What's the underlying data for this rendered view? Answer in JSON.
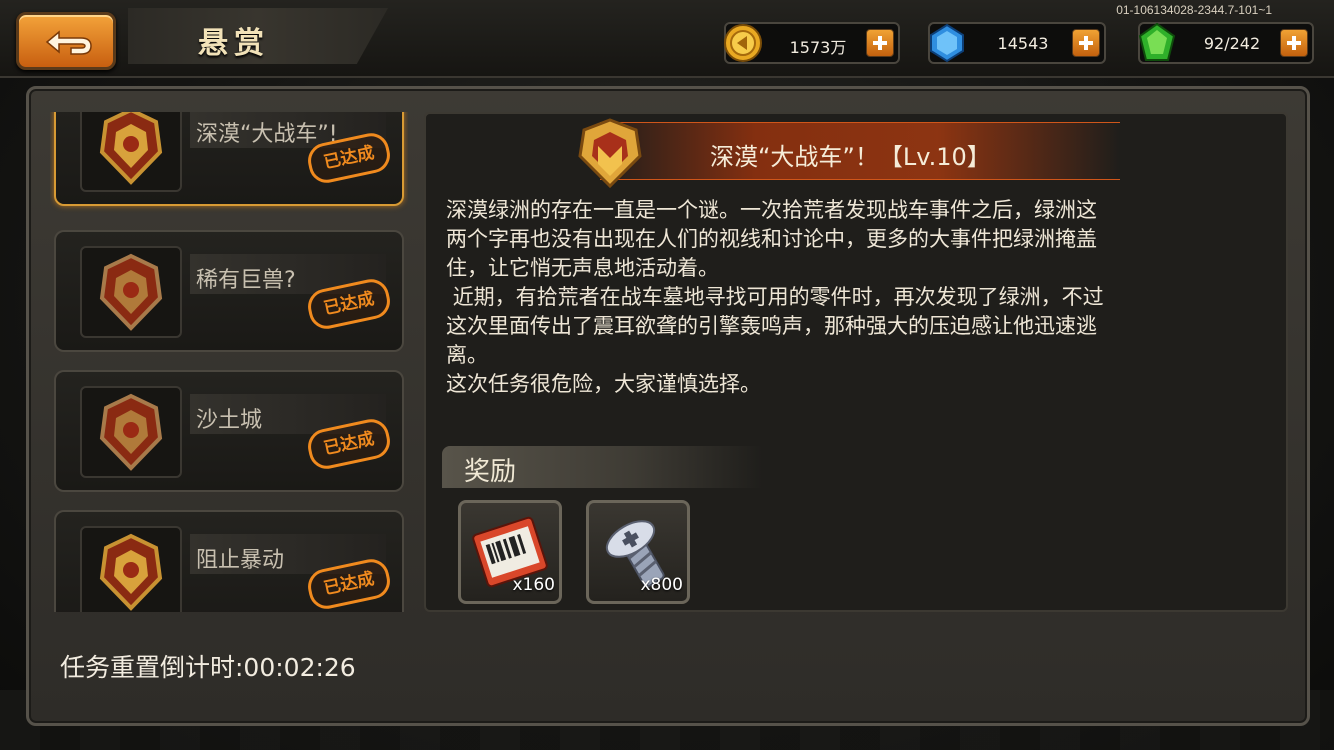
{
  "header": {
    "title": "悬赏",
    "version": "01-106134028-2344.7-101~1"
  },
  "resources": [
    {
      "icon": "gold-coin-icon",
      "value": "1573万"
    },
    {
      "icon": "blue-gem-icon",
      "value": "14543"
    },
    {
      "icon": "green-energy-icon",
      "value": "92/242"
    }
  ],
  "quests": [
    {
      "name": "深漠“大战车”!",
      "status": "已达成",
      "selected": true
    },
    {
      "name": "稀有巨兽?",
      "status": "已达成",
      "selected": false
    },
    {
      "name": "沙土城",
      "status": "已达成",
      "selected": false
    },
    {
      "name": "阻止暴动",
      "status": "已达成",
      "selected": false
    }
  ],
  "detail": {
    "title": "深漠“大战车”！【Lv.10】",
    "description": "深漠绿洲的存在一直是一个谜。一次拾荒者发现战车事件之后，绿洲这\n两个字再也没有出现在人们的视线和讨论中，更多的大事件把绿洲掩盖\n住，让它悄无声息地活动着。\n 近期，有拾荒者在战车墓地寻找可用的零件时，再次发现了绿洲，不过\n这次里面传出了震耳欲聋的引擎轰鸣声，那种强大的压迫感让他迅速逃\n离。\n这次任务很危险，大家谨慎选择。",
    "reward_label": "奖励",
    "rewards": [
      {
        "icon": "ticket-icon",
        "qty": "x160"
      },
      {
        "icon": "screw-icon",
        "qty": "x800"
      }
    ]
  },
  "footer": {
    "timer": "任务重置倒计时:00:02:26"
  },
  "colors": {
    "accent_orange": "#f08a1e",
    "title_gold": "#f2e2b8",
    "selected_border": "#d89a34"
  }
}
